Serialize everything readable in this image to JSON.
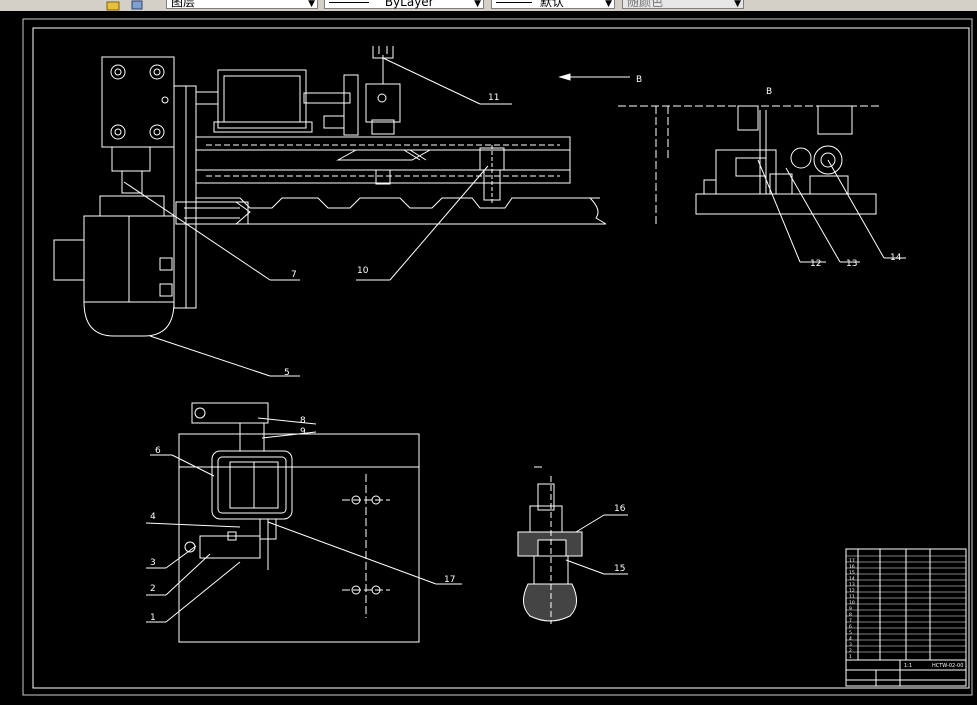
{
  "toolbar": {
    "layer_value": "图层",
    "linetype_value": "ByLayer",
    "lineweight_value": "默认",
    "color_value": "随颜色"
  },
  "view_label": "B",
  "section_label": "B",
  "callouts": {
    "c1": "1",
    "c2": "2",
    "c3": "3",
    "c4": "4",
    "c5": "5",
    "c6": "6",
    "c7": "7",
    "c8": "8",
    "c9": "9",
    "c10": "10",
    "c11": "11",
    "c12": "12",
    "c13": "13",
    "c14": "14",
    "c15": "15",
    "c16": "16",
    "c17": "17"
  },
  "title_block": {
    "drawing_no": "HCTW-02-00",
    "scale": "1:1",
    "rows": [
      "1",
      "2",
      "3",
      "4",
      "5",
      "6",
      "7",
      "8",
      "9",
      "10",
      "11",
      "12",
      "13",
      "14",
      "15",
      "16",
      "17"
    ]
  }
}
